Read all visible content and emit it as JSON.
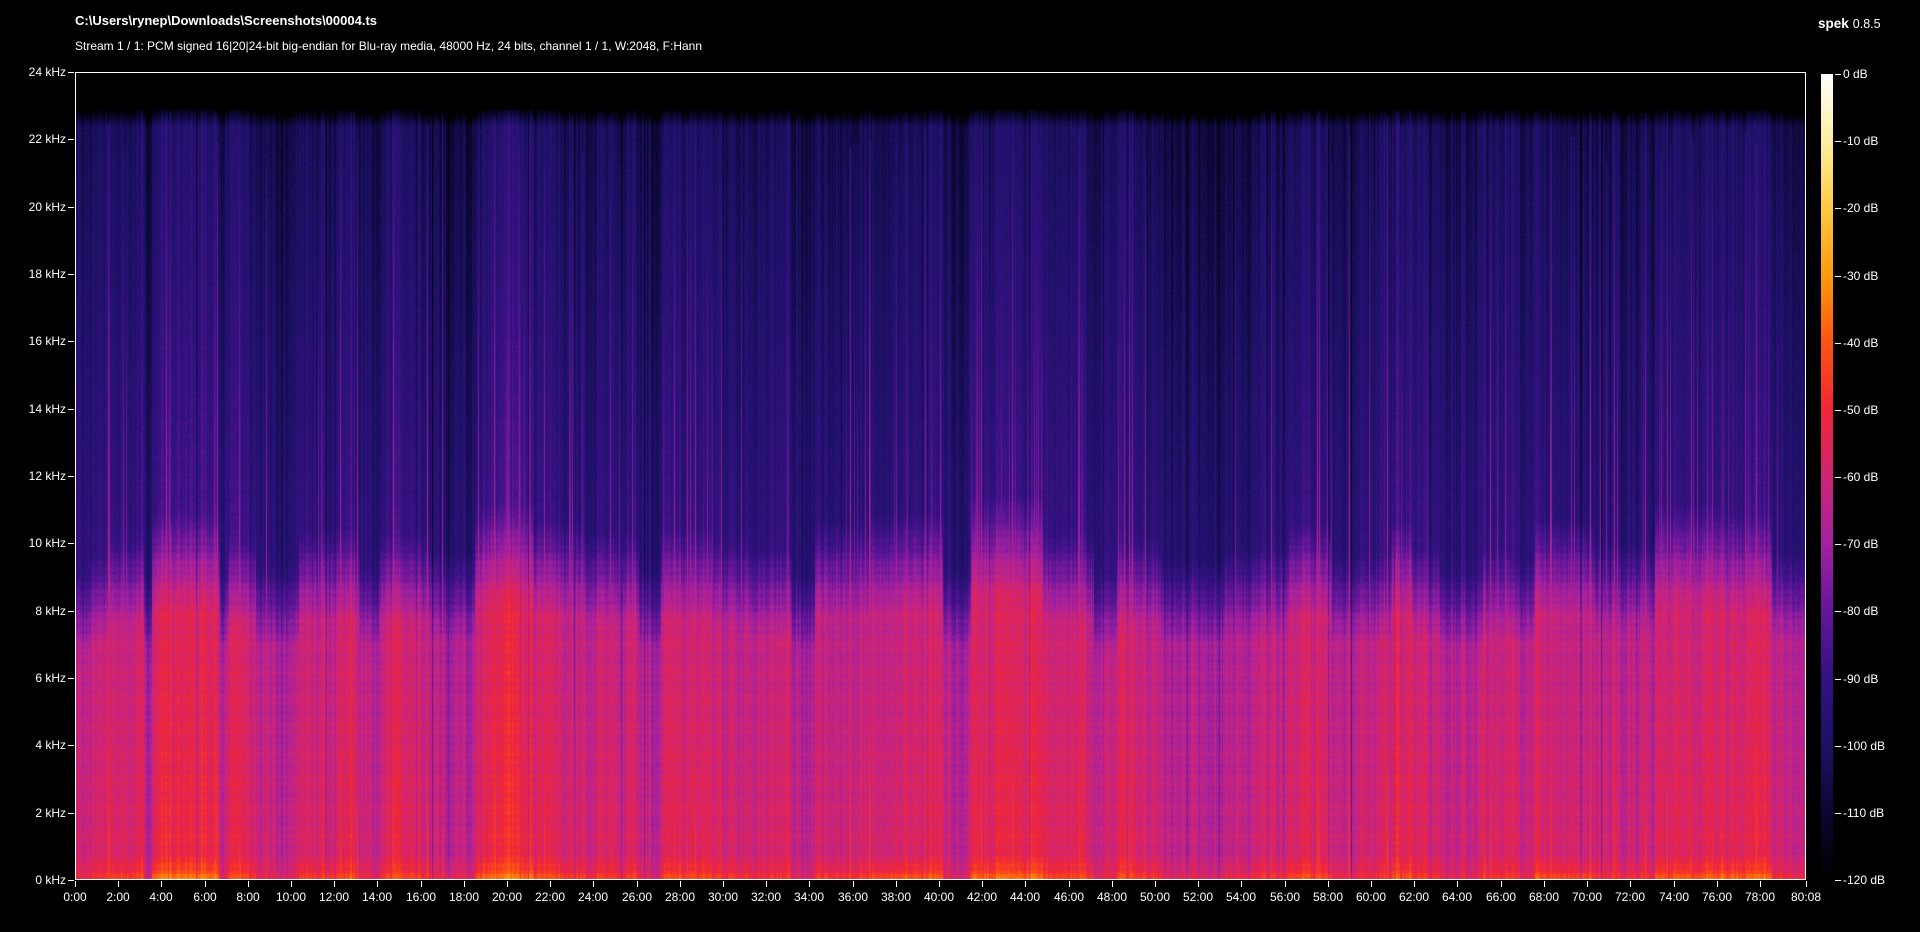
{
  "app": {
    "name": "spek",
    "version": "0.8.5"
  },
  "header": {
    "title": "C:\\Users\\rynep\\Downloads\\Screenshots\\00004.ts",
    "subtitle": "Stream 1 / 1: PCM signed 16|20|24-bit big-endian for Blu-ray media, 48000 Hz, 24 bits, channel 1 / 1, W:2048, F:Hann"
  },
  "chart_data": {
    "type": "heatmap",
    "subtype": "audio-spectrogram",
    "title": "C:\\Users\\rynep\\Downloads\\Screenshots\\00004.ts",
    "subtitle": "Stream 1 / 1: PCM signed 16|20|24-bit big-endian for Blu-ray media, 48000 Hz, 24 bits, channel 1 / 1, W:2048, F:Hann",
    "x_axis": {
      "unit": "time",
      "duration_s": 4808,
      "tick_times_s": [
        0,
        120,
        240,
        360,
        480,
        600,
        720,
        840,
        960,
        1080,
        1200,
        1320,
        1440,
        1560,
        1680,
        1800,
        1920,
        2040,
        2160,
        2280,
        2400,
        2520,
        2640,
        2760,
        2880,
        3000,
        3120,
        3240,
        3360,
        3480,
        3600,
        3720,
        3840,
        3960,
        4080,
        4200,
        4320,
        4440,
        4560,
        4680,
        4808
      ],
      "tick_labels": [
        "0:00",
        "2:00",
        "4:00",
        "6:00",
        "8:00",
        "10:00",
        "12:00",
        "14:00",
        "16:00",
        "18:00",
        "20:00",
        "22:00",
        "24:00",
        "26:00",
        "28:00",
        "30:00",
        "32:00",
        "34:00",
        "36:00",
        "38:00",
        "40:00",
        "42:00",
        "44:00",
        "46:00",
        "48:00",
        "50:00",
        "52:00",
        "54:00",
        "56:00",
        "58:00",
        "60:00",
        "62:00",
        "64:00",
        "66:00",
        "68:00",
        "70:00",
        "72:00",
        "74:00",
        "76:00",
        "78:00",
        "80:08"
      ]
    },
    "y_axis": {
      "unit": "kHz",
      "min": 0,
      "max": 24,
      "tick_labels": [
        "24 kHz",
        "22 kHz",
        "20 kHz",
        "18 kHz",
        "16 kHz",
        "14 kHz",
        "12 kHz",
        "10 kHz",
        "8 kHz",
        "6 kHz",
        "4 kHz",
        "2 kHz",
        "0 kHz"
      ]
    },
    "legend": {
      "unit": "dB",
      "max": 0,
      "min": -120,
      "tick_labels": [
        "0 dB",
        "-10 dB",
        "-20 dB",
        "-30 dB",
        "-40 dB",
        "-50 dB",
        "-60 dB",
        "-70 dB",
        "-80 dB",
        "-90 dB",
        "-100 dB",
        "-110 dB",
        "-120 dB"
      ]
    },
    "palette": [
      [
        0.0,
        "#000000"
      ],
      [
        0.083,
        "#0c0733"
      ],
      [
        0.167,
        "#1d1166"
      ],
      [
        0.25,
        "#341181"
      ],
      [
        0.333,
        "#641798"
      ],
      [
        0.417,
        "#a321a0"
      ],
      [
        0.5,
        "#cf2576"
      ],
      [
        0.583,
        "#f12637"
      ],
      [
        0.667,
        "#fd5411"
      ],
      [
        0.75,
        "#ff9a0e"
      ],
      [
        0.833,
        "#ffc944"
      ],
      [
        0.917,
        "#feefa2"
      ],
      [
        1.0,
        "#ffffff"
      ]
    ],
    "content_ceiling_hz": 22900,
    "segments": [
      {
        "t0": 0,
        "t1": 40,
        "level": 0.35,
        "warmth": 0.15,
        "spikes": 0.0,
        "cutoff_hz": 7000
      },
      {
        "t0": 40,
        "t1": 90,
        "level": 0.55,
        "warmth": 0.3,
        "spikes": 0.1,
        "cutoff_hz": 7400
      },
      {
        "t0": 90,
        "t1": 190,
        "level": 0.68,
        "warmth": 0.5,
        "spikes": 0.2,
        "cutoff_hz": 7800
      },
      {
        "t0": 190,
        "t1": 212,
        "level": 0.15,
        "warmth": 0.0,
        "spikes": 0.0,
        "cutoff_hz": 7000
      },
      {
        "t0": 212,
        "t1": 400,
        "level": 0.85,
        "warmth": 0.9,
        "spikes": 0.4,
        "cutoff_hz": 8400
      },
      {
        "t0": 400,
        "t1": 424,
        "level": 0.2,
        "warmth": 0.0,
        "spikes": 0.0,
        "cutoff_hz": 7000
      },
      {
        "t0": 424,
        "t1": 500,
        "level": 0.66,
        "warmth": 0.45,
        "spikes": 0.15,
        "cutoff_hz": 7800
      },
      {
        "t0": 500,
        "t1": 620,
        "level": 0.38,
        "warmth": 0.1,
        "spikes": 0.05,
        "cutoff_hz": 7200
      },
      {
        "t0": 620,
        "t1": 790,
        "level": 0.7,
        "warmth": 0.5,
        "spikes": 0.25,
        "cutoff_hz": 8000
      },
      {
        "t0": 790,
        "t1": 842,
        "level": 0.42,
        "warmth": 0.15,
        "spikes": 0.05,
        "cutoff_hz": 7200
      },
      {
        "t0": 842,
        "t1": 986,
        "level": 0.68,
        "warmth": 0.45,
        "spikes": 0.25,
        "cutoff_hz": 7900
      },
      {
        "t0": 986,
        "t1": 1110,
        "level": 0.52,
        "warmth": 0.25,
        "spikes": 0.1,
        "cutoff_hz": 7500
      },
      {
        "t0": 1110,
        "t1": 1272,
        "level": 0.9,
        "warmth": 0.75,
        "spikes": 0.6,
        "cutoff_hz": 8600
      },
      {
        "t0": 1272,
        "t1": 1410,
        "level": 0.8,
        "warmth": 0.6,
        "spikes": 0.35,
        "cutoff_hz": 8200
      },
      {
        "t0": 1410,
        "t1": 1566,
        "level": 0.7,
        "warmth": 0.45,
        "spikes": 0.2,
        "cutoff_hz": 7900
      },
      {
        "t0": 1566,
        "t1": 1628,
        "level": 0.35,
        "warmth": 0.1,
        "spikes": 0.0,
        "cutoff_hz": 7100
      },
      {
        "t0": 1628,
        "t1": 1770,
        "level": 0.72,
        "warmth": 0.55,
        "spikes": 0.3,
        "cutoff_hz": 8000
      },
      {
        "t0": 1770,
        "t1": 1872,
        "level": 0.66,
        "warmth": 0.45,
        "spikes": 0.15,
        "cutoff_hz": 7800
      },
      {
        "t0": 1872,
        "t1": 1992,
        "level": 0.6,
        "warmth": 0.3,
        "spikes": 0.1,
        "cutoff_hz": 7600
      },
      {
        "t0": 1992,
        "t1": 2054,
        "level": 0.32,
        "warmth": 0.05,
        "spikes": 0.0,
        "cutoff_hz": 7000
      },
      {
        "t0": 2054,
        "t1": 2204,
        "level": 0.75,
        "warmth": 0.55,
        "spikes": 0.5,
        "cutoff_hz": 8200
      },
      {
        "t0": 2204,
        "t1": 2412,
        "level": 0.85,
        "warmth": 0.8,
        "spikes": 0.4,
        "cutoff_hz": 8400
      },
      {
        "t0": 2412,
        "t1": 2490,
        "level": 0.35,
        "warmth": 0.1,
        "spikes": 0.0,
        "cutoff_hz": 7100
      },
      {
        "t0": 2490,
        "t1": 2690,
        "level": 0.95,
        "warmth": 0.85,
        "spikes": 0.75,
        "cutoff_hz": 8800
      },
      {
        "t0": 2690,
        "t1": 2832,
        "level": 0.72,
        "warmth": 0.5,
        "spikes": 0.2,
        "cutoff_hz": 7900
      },
      {
        "t0": 2832,
        "t1": 2894,
        "level": 0.3,
        "warmth": 0.05,
        "spikes": 0.0,
        "cutoff_hz": 7000
      },
      {
        "t0": 2894,
        "t1": 3018,
        "level": 0.66,
        "warmth": 0.5,
        "spikes": 0.2,
        "cutoff_hz": 7800
      },
      {
        "t0": 3018,
        "t1": 3192,
        "level": 0.46,
        "warmth": 0.2,
        "spikes": 0.08,
        "cutoff_hz": 7300
      },
      {
        "t0": 3192,
        "t1": 3372,
        "level": 0.62,
        "warmth": 0.4,
        "spikes": 0.12,
        "cutoff_hz": 7600
      },
      {
        "t0": 3372,
        "t1": 3494,
        "level": 0.78,
        "warmth": 0.6,
        "spikes": 0.4,
        "cutoff_hz": 8200
      },
      {
        "t0": 3494,
        "t1": 3656,
        "level": 0.5,
        "warmth": 0.25,
        "spikes": 0.1,
        "cutoff_hz": 7400
      },
      {
        "t0": 3656,
        "t1": 3716,
        "level": 0.75,
        "warmth": 0.55,
        "spikes": 0.45,
        "cutoff_hz": 8200
      },
      {
        "t0": 3716,
        "t1": 3794,
        "level": 0.6,
        "warmth": 0.35,
        "spikes": 0.1,
        "cutoff_hz": 7600
      },
      {
        "t0": 3794,
        "t1": 3912,
        "level": 0.36,
        "warmth": 0.1,
        "spikes": 0.0,
        "cutoff_hz": 7100
      },
      {
        "t0": 3912,
        "t1": 3990,
        "level": 0.6,
        "warmth": 0.4,
        "spikes": 0.12,
        "cutoff_hz": 7600
      },
      {
        "t0": 3990,
        "t1": 4058,
        "level": 0.46,
        "warmth": 0.2,
        "spikes": 0.05,
        "cutoff_hz": 7300
      },
      {
        "t0": 4058,
        "t1": 4220,
        "level": 0.8,
        "warmth": 0.75,
        "spikes": 0.45,
        "cutoff_hz": 8300
      },
      {
        "t0": 4220,
        "t1": 4392,
        "level": 0.62,
        "warmth": 0.4,
        "spikes": 0.35,
        "cutoff_hz": 7700
      },
      {
        "t0": 4392,
        "t1": 4574,
        "level": 0.88,
        "warmth": 0.8,
        "spikes": 0.65,
        "cutoff_hz": 8600
      },
      {
        "t0": 4574,
        "t1": 4716,
        "level": 0.84,
        "warmth": 0.85,
        "spikes": 0.5,
        "cutoff_hz": 8400
      },
      {
        "t0": 4716,
        "t1": 4808,
        "level": 0.55,
        "warmth": 0.35,
        "spikes": 0.1,
        "cutoff_hz": 7500
      }
    ]
  }
}
